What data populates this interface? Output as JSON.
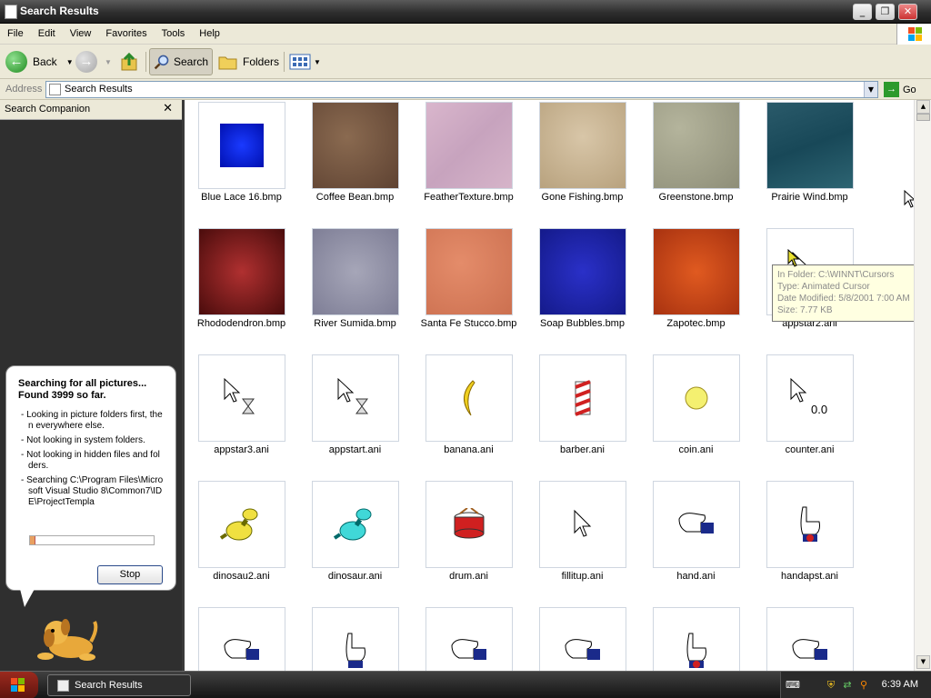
{
  "window": {
    "title": "Search Results"
  },
  "menu": [
    "File",
    "Edit",
    "View",
    "Favorites",
    "Tools",
    "Help"
  ],
  "toolbar": {
    "back_label": "Back",
    "search_label": "Search",
    "folders_label": "Folders"
  },
  "address": {
    "label": "Address",
    "value": "Search Results",
    "go_label": "Go"
  },
  "companion": {
    "title": "Search Companion",
    "heading": "Searching for all pictures... Found 3999 so far.",
    "bullets": [
      "- Looking in picture folders first, then everywhere else.",
      "- Not looking in system folders.",
      "- Not looking in hidden files and folders.",
      "- Searching C:\\Program Files\\Microsoft Visual Studio 8\\Common7\\IDE\\ProjectTempla"
    ],
    "stop_label": "Stop"
  },
  "files": [
    {
      "name": "Blue Lace 16.bmp",
      "thumb": "blue-lace"
    },
    {
      "name": "Coffee Bean.bmp",
      "thumb": "coffee-bean"
    },
    {
      "name": "FeatherTexture.bmp",
      "thumb": "feather"
    },
    {
      "name": "Gone Fishing.bmp",
      "thumb": "gone-fishing"
    },
    {
      "name": "Greenstone.bmp",
      "thumb": "greenstone"
    },
    {
      "name": "Prairie Wind.bmp",
      "thumb": "prairie-wind"
    },
    {
      "name": "Rhododendron.bmp",
      "thumb": "rhododendron"
    },
    {
      "name": "River Sumida.bmp",
      "thumb": "river-sumida"
    },
    {
      "name": "Santa Fe Stucco.bmp",
      "thumb": "santa-fe"
    },
    {
      "name": "Soap Bubbles.bmp",
      "thumb": "soap-bubbles"
    },
    {
      "name": "Zapotec.bmp",
      "thumb": "zapotec"
    },
    {
      "name": "appstar2.ani",
      "thumb": "hourglass-cursor-icon"
    },
    {
      "name": "appstar3.ani",
      "thumb": "hourglass-cursor-icon"
    },
    {
      "name": "appstart.ani",
      "thumb": "hourglass-cursor-icon"
    },
    {
      "name": "banana.ani",
      "thumb": "banana-icon"
    },
    {
      "name": "barber.ani",
      "thumb": "barber-pole-icon"
    },
    {
      "name": "coin.ani",
      "thumb": "coin-icon"
    },
    {
      "name": "counter.ani",
      "thumb": "counter-cursor-icon"
    },
    {
      "name": "dinosau2.ani",
      "thumb": "dinosaur-yellow-icon"
    },
    {
      "name": "dinosaur.ani",
      "thumb": "dinosaur-cyan-icon"
    },
    {
      "name": "drum.ani",
      "thumb": "drum-icon"
    },
    {
      "name": "fillitup.ani",
      "thumb": "arrow-cursor-icon"
    },
    {
      "name": "hand.ani",
      "thumb": "hand-icon"
    },
    {
      "name": "handapst.ani",
      "thumb": "hand-wait-icon"
    },
    {
      "name": "",
      "thumb": "hand-icon"
    },
    {
      "name": "",
      "thumb": "hand-point-icon"
    },
    {
      "name": "",
      "thumb": "hand-icon"
    },
    {
      "name": "",
      "thumb": "hand-icon"
    },
    {
      "name": "",
      "thumb": "hand-wait-icon"
    },
    {
      "name": "",
      "thumb": "hand-icon"
    }
  ],
  "tooltip": {
    "folder": "In Folder: C:\\WINNT\\Cursors",
    "type": "Type: Animated Cursor",
    "modified": "Date Modified: 5/8/2001 7:00 AM",
    "size": "Size: 7.77 KB"
  },
  "taskbar": {
    "task_label": "Search Results",
    "clock": "6:39 AM"
  }
}
